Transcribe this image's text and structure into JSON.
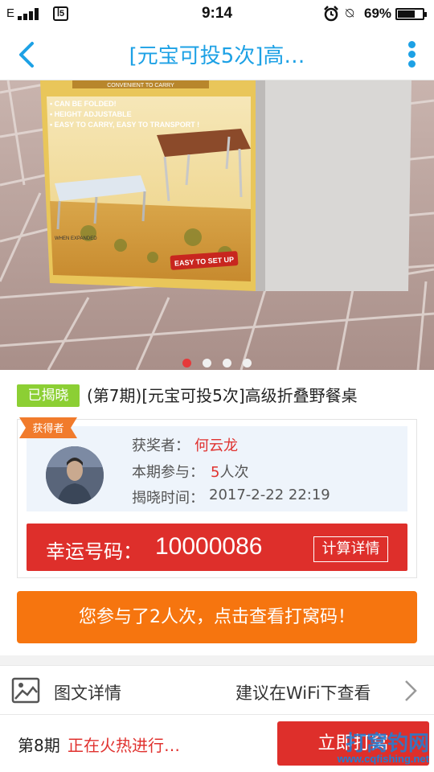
{
  "status_bar": {
    "carrier_mark": "E",
    "sim_label": "ꟾ5",
    "time": "9:14",
    "battery_percent": "69%",
    "battery_level": 0.69
  },
  "header": {
    "title": "[元宝可投5次]高…",
    "accent_color": "#1da1e5"
  },
  "banner": {
    "slide_count": 4,
    "active_slide": 0,
    "box_print": {
      "line0": "CONVENIENT TO CARRY",
      "line1": "• CAN BE FOLDED!",
      "line2": "• HEIGHT ADJUSTABLE",
      "line3": "• EASY TO CARRY, EASY TO TRANSPORT !",
      "line4": "WHEN EXPANDED",
      "line5": "EASY TO SET UP"
    }
  },
  "product": {
    "status_badge": "已揭晓",
    "title": "(第7期)[元宝可投5次]高级折叠野餐桌"
  },
  "winner": {
    "ribbon": "获得者",
    "winner_label": "获奖者：",
    "winner_name": "何云龙",
    "participation_label": "本期参与：",
    "participation_count": "5",
    "participation_unit": "人次",
    "reveal_time_label": "揭晓时间：",
    "reveal_time": "2017-2-22 22:19",
    "lucky_label": "幸运号码：",
    "lucky_number": "10000086",
    "calc_details_label": "计算详情"
  },
  "participate_button": "您参与了2人次，点击查看打窝码！",
  "detail_row": {
    "label": "图文详情",
    "hint": "建议在WiFi下查看",
    "icon": "image-icon"
  },
  "bottom_bar": {
    "period": "第8期",
    "status": "正在火热进行…",
    "button_label": "立即打窝",
    "watermark_title": "打窝钓网",
    "watermark_url": "www.cqfishing.net"
  },
  "colors": {
    "red": "#de2f2b",
    "orange": "#f6750f",
    "green_badge": "#8ccf34"
  }
}
